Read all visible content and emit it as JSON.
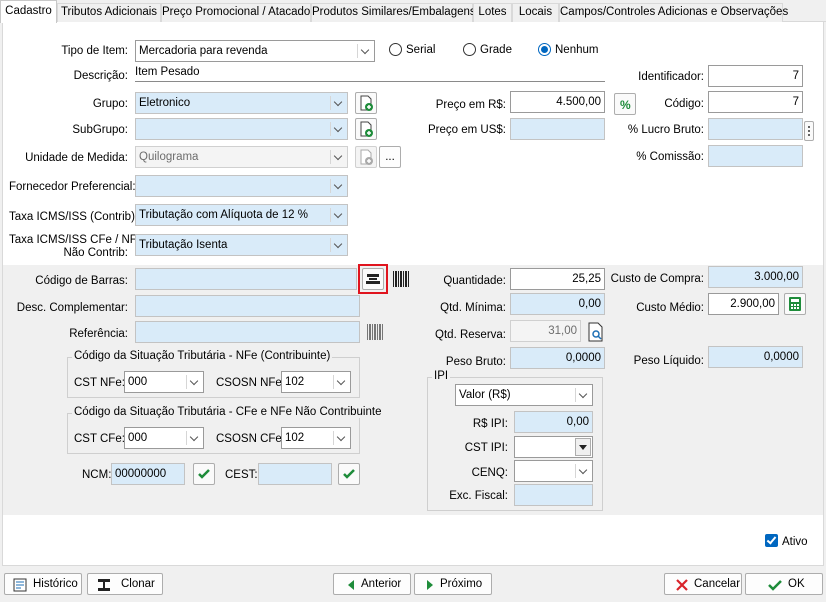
{
  "tabs": [
    "Cadastro",
    "Tributos Adicionais",
    "Preço Promocional / Atacado",
    "Produtos Similares/Embalagens",
    "Lotes",
    "Locais",
    "Campos/Controles Adicionas e Observações"
  ],
  "form": {
    "tipo_item_label": "Tipo de Item:",
    "tipo_item_value": "Mercadoria para revenda",
    "radio_serial": "Serial",
    "radio_grade": "Grade",
    "radio_nenhum": "Nenhum",
    "descricao_label": "Descrição:",
    "descricao_value": "Item Pesado",
    "identificador_label": "Identificador:",
    "identificador_value": "7",
    "grupo_label": "Grupo:",
    "grupo_value": "Eletronico",
    "preco_rs_label": "Preço em R$:",
    "preco_rs_value": "4.500,00",
    "codigo_label": "Código:",
    "codigo_value": "7",
    "subgrupo_label": "SubGrupo:",
    "preco_us_label": "Preço em US$:",
    "lucro_label": "% Lucro Bruto:",
    "unidade_label": "Unidade de Medida:",
    "unidade_value": "Quilograma",
    "more_label": "...",
    "comissao_label": "% Comissão:",
    "fornecedor_label": "Fornecedor Preferencial:",
    "icms_label": "Taxa ICMS/ISS (Contrib):",
    "icms_value": "Tributação com Alíquota de 12 %",
    "icms_nc_label_1": "Taxa ICMS/ISS CFe / NFe",
    "icms_nc_label_2": "Não Contrib:",
    "icms_nc_value": "Tributação Isenta",
    "barras_label": "Código de Barras:",
    "quantidade_label": "Quantidade:",
    "quantidade_value": "25,25",
    "custo_compra_label": "Custo de Compra:",
    "custo_compra_value": "3.000,00",
    "desc_comp_label": "Desc. Complementar:",
    "qtd_min_label": "Qtd. Mínima:",
    "qtd_min_value": "0,00",
    "custo_medio_label": "Custo Médio:",
    "custo_medio_value": "2.900,00",
    "referencia_label": "Referência:",
    "qtd_reserva_label": "Qtd. Reserva:",
    "qtd_reserva_value": "31,00",
    "peso_bruto_label": "Peso Bruto:",
    "peso_bruto_value": "0,0000",
    "peso_liquido_label": "Peso Líquido:",
    "peso_liquido_value": "0,0000",
    "cst_nfe_group": "Código da Situação Tributária - NFe (Contribuinte)",
    "cst_nfe_label": "CST NFe:",
    "cst_nfe_value": "000",
    "csosn_nfe_label": "CSOSN NFe:",
    "csosn_nfe_value": "102",
    "cst_cfe_group": "Código da Situação Tributária - CFe e NFe Não Contribuinte",
    "cst_cfe_label": "CST CFe:",
    "cst_cfe_value": "000",
    "csosn_cfe_label": "CSOSN CFe:",
    "csosn_cfe_value": "102",
    "ncm_label": "NCM:",
    "ncm_value": "00000000",
    "cest_label": "CEST:",
    "ipi_group": "IPI",
    "ipi_tipo_value": "Valor (R$)",
    "rs_ipi_label": "R$ IPI:",
    "rs_ipi_value": "0,00",
    "cst_ipi_label": "CST IPI:",
    "cenq_label": "CENQ:",
    "exc_fiscal_label": "Exc. Fiscal:",
    "ativo_label": "Ativo"
  },
  "buttons": {
    "historico": "Histórico",
    "clonar": "Clonar",
    "anterior": "Anterior",
    "proximo": "Próximo",
    "cancelar": "Cancelar",
    "ok": "OK"
  },
  "colors": {
    "field_bg": "#d9ebf9",
    "accent": "#0067c0",
    "highlight": "#e0141e",
    "green": "#1e8c3a"
  }
}
